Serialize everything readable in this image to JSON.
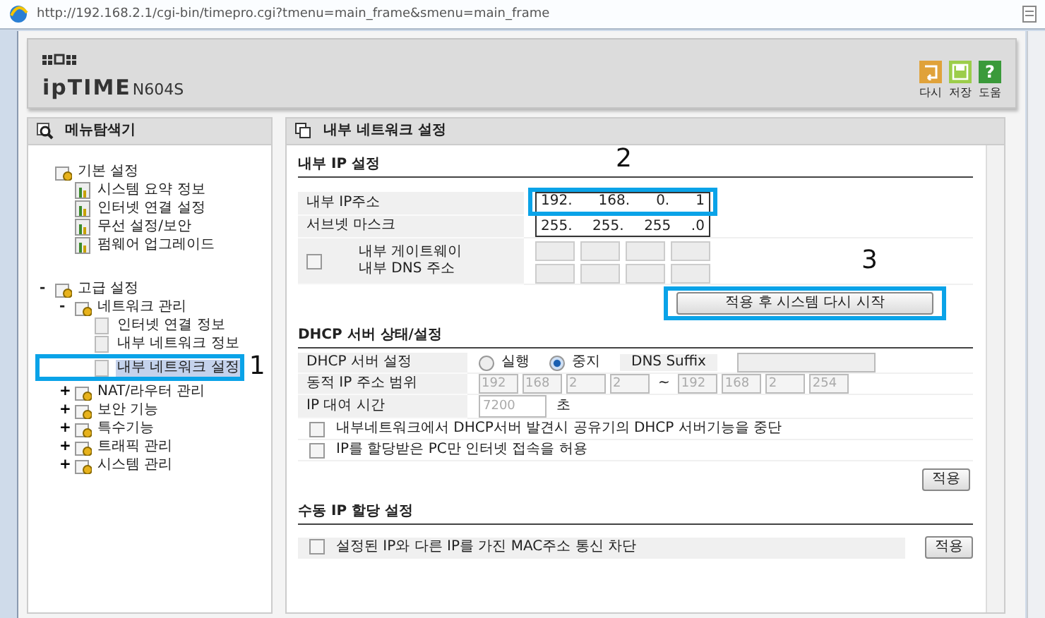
{
  "browser": {
    "url": "http://192.168.2.1/cgi-bin/timepro.cgi?tmenu=main_frame&smenu=main_frame"
  },
  "header": {
    "logo": "ipTIME",
    "model": "N604S",
    "tools": [
      {
        "kind": "undo",
        "label": "다시"
      },
      {
        "kind": "save",
        "label": "저장"
      },
      {
        "kind": "help",
        "glyph": "?",
        "label": "도움"
      }
    ]
  },
  "sidebar": {
    "title": "메뉴탐색기",
    "tree": [
      {
        "label": "기본 설정",
        "kind": "folder",
        "children": [
          {
            "label": "시스템 요약 정보",
            "kind": "tool",
            "selected": false
          },
          {
            "label": "인터넷 연결 설정",
            "kind": "tool",
            "selected": false
          },
          {
            "label": "무선 설정/보안",
            "kind": "tool",
            "selected": false
          },
          {
            "label": "펌웨어 업그레이드",
            "kind": "tool",
            "selected": false
          }
        ]
      },
      {
        "label": "고급 설정",
        "kind": "folder",
        "toggle": "-",
        "expanded": true,
        "children": [
          {
            "label": "네트워크 관리",
            "kind": "folder",
            "toggle": "-",
            "expanded": true,
            "children": [
              {
                "label": "인터넷 연결 정보",
                "kind": "page",
                "selected": false
              },
              {
                "label": "내부 네트워크 정보",
                "kind": "page",
                "selected": false
              },
              {
                "label": "내부 네트워크 설정",
                "kind": "page",
                "selected": true
              }
            ]
          },
          {
            "label": "NAT/라우터 관리",
            "kind": "folder",
            "toggle": "+",
            "expanded": false
          },
          {
            "label": "보안 기능",
            "kind": "folder",
            "toggle": "+",
            "expanded": false
          },
          {
            "label": "특수기능",
            "kind": "folder",
            "toggle": "+",
            "expanded": false
          },
          {
            "label": "트래픽 관리",
            "kind": "folder",
            "toggle": "+",
            "expanded": false
          },
          {
            "label": "시스템 관리",
            "kind": "folder",
            "toggle": "+",
            "expanded": false
          }
        ]
      }
    ]
  },
  "page_title": "내부 네트워크 설정",
  "lan_ip": {
    "title": "내부 IP 설정",
    "ip_label": "내부 IP주소",
    "ip": [
      "192.",
      "168.",
      "0.",
      "1"
    ],
    "mask_label": "서브넷 마스크",
    "mask": [
      "255.",
      "255.",
      "255",
      ".0"
    ],
    "custom_gateway": {
      "checked": false
    },
    "gateway_label": "내부 게이트웨이",
    "dns_label": "내부 DNS 주소",
    "restart_button": "적용 후 시스템 다시 시작"
  },
  "dhcp": {
    "title": "DHCP 서버 상태/설정",
    "server_label": "DHCP 서버 설정",
    "modes": [
      {
        "label": "실행",
        "selected": false
      },
      {
        "label": "중지",
        "selected": true
      }
    ],
    "dns_suffix_label": "DNS Suffix",
    "range_label": "동적 IP 주소 범위",
    "range_disabled": true,
    "range_start": [
      "192",
      "168",
      "2",
      "2"
    ],
    "range_sep": "~",
    "range_end": [
      "192",
      "168",
      "2",
      "254"
    ],
    "lease_label": "IP 대여 시간",
    "lease": "7200",
    "lease_unit": "초",
    "options": [
      {
        "label": "내부네트워크에서 DHCP서버 발견시 공유기의 DHCP 서버기능을 중단",
        "checked": false
      },
      {
        "label": "IP를 할당받은 PC만 인터넷 접속을 허용",
        "checked": false
      }
    ],
    "apply": "적용"
  },
  "manual": {
    "title": "수동 IP 할당 설정",
    "options": [
      {
        "label": "설정된 IP와 다른 IP를 가진 MAC주소 통신 차단",
        "checked": false
      }
    ],
    "apply": "적용"
  },
  "annotations": [
    {
      "label": "1"
    },
    {
      "label": "2"
    },
    {
      "label": "3"
    }
  ]
}
